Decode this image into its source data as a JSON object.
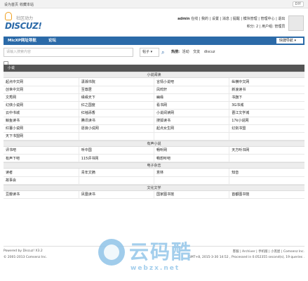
{
  "topbar": {
    "set_home": "设为首页",
    "bookmark": "收藏本站",
    "diy": "DIY"
  },
  "logo": {
    "word": "DISCUZ!",
    "sub": "社区动力"
  },
  "user": {
    "line1": [
      "admin",
      "在线",
      "我的",
      "设置",
      "消息",
      "提醒",
      "模块管理",
      "管理中心",
      "退出"
    ],
    "line2": [
      "积分: 2",
      "用户组: 管理员"
    ]
  },
  "nav": {
    "items": [
      "MicXP网址导航",
      "论坛"
    ],
    "quick": "快捷导航"
  },
  "search": {
    "placeholder": "请输入搜索内容",
    "type": "帖子",
    "hot_label": "热搜:",
    "hot": [
      "活动",
      "交友",
      "discuz"
    ]
  },
  "category": "小说",
  "sections": [
    {
      "title": "小说阅读",
      "rows": [
        [
          "起点中文网",
          "潇湘书院",
          "言情小说吧",
          "纵横中文网"
        ],
        [
          "创世中文网",
          "至尊居",
          "凤鸣轩",
          "新浪读书"
        ],
        [
          "文秀网",
          "缘缘天下",
          "幽缘",
          "书旗下"
        ],
        [
          "幻侠小说网",
          "红之国度",
          "看书网",
          "3G书城"
        ],
        [
          "云中书城",
          "红袖添香",
          "小说阅读网",
          "晋江文学城"
        ],
        [
          "鲸鱼读书",
          "腾讯读书",
          "搜狐读书",
          "17k小说网"
        ],
        [
          "红薯小说网",
          "逐浪小说网",
          "起点女生网",
          "幻剑书盟"
        ],
        [
          "天下书盟网",
          "",
          "",
          ""
        ]
      ]
    },
    {
      "title": "有声小说",
      "rows": [
        [
          "评书吧",
          "听中国",
          "畅听网",
          "天方听书网"
        ],
        [
          "有声下吧",
          "115评书网",
          "畅想听吧",
          ""
        ]
      ]
    },
    {
      "title": "电子杂志",
      "rows": [
        [
          "读者",
          "青年文摘",
          "意林",
          "知音"
        ],
        [
          "故事会",
          "",
          "",
          ""
        ]
      ]
    },
    {
      "title": "文化文学",
      "rows": [
        [
          "豆瓣读书",
          "凤凰读书",
          "国家图书馆",
          "首都图书馆"
        ]
      ]
    }
  ],
  "footer": {
    "powered": "Powered by Discuz! X3.2",
    "copyright": "© 2001-2013 Comsenz Inc.",
    "links": "客服 | Archiver | 手机版 | 小黑屋 | Comsenz Inc.",
    "time": "GMT+8, 2015-3-30 14:52 , Processed in 0.052355 second(s), 19 queries ."
  },
  "watermark": {
    "text": "云码酷",
    "url": "webzx.net"
  }
}
